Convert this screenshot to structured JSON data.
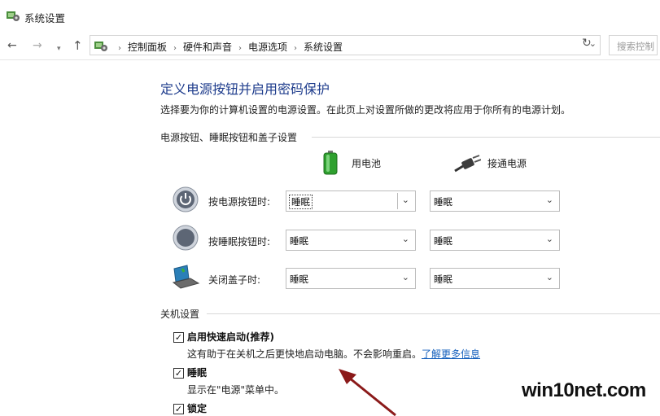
{
  "window": {
    "title": "系统设置"
  },
  "nav": {
    "back": "←",
    "forward": "→",
    "recent": "▾",
    "up": "↑",
    "breadcrumbs": [
      "控制面板",
      "硬件和声音",
      "电源选项",
      "系统设置"
    ],
    "dropdown": "⌄",
    "refresh": "↻",
    "search_placeholder": "搜索控制"
  },
  "page": {
    "title": "定义电源按钮并启用密码保护",
    "description": "选择要为你的计算机设置的电源设置。在此页上对设置所做的更改将应用于你所有的电源计划。"
  },
  "buttons_section": {
    "title": "电源按钮、睡眠按钮和盖子设置",
    "col_battery": "用电池",
    "col_plugged": "接通电源",
    "rows": [
      {
        "label": "按电源按钮时:",
        "battery": "睡眠",
        "plugged": "睡眠"
      },
      {
        "label": "按睡眠按钮时:",
        "battery": "睡眠",
        "plugged": "睡眠"
      },
      {
        "label": "关闭盖子时:",
        "battery": "睡眠",
        "plugged": "睡眠"
      }
    ]
  },
  "shutdown_section": {
    "title": "关机设置",
    "fast_startup": {
      "label": "启用快速启动(推荐)",
      "checked": true,
      "desc": "这有助于在关机之后更快地启动电脑。不会影响重启。",
      "link": "了解更多信息"
    },
    "sleep": {
      "label": "睡眠",
      "checked": true,
      "desc": "显示在\"电源\"菜单中。"
    },
    "lock": {
      "label": "锁定",
      "checked": true
    }
  },
  "check_glyph": "✓",
  "chevron": "⌄",
  "watermark": "win10net.com",
  "colors": {
    "title": "#1e3c8c",
    "link": "#1560bd",
    "arrow": "#8b1a1a"
  }
}
